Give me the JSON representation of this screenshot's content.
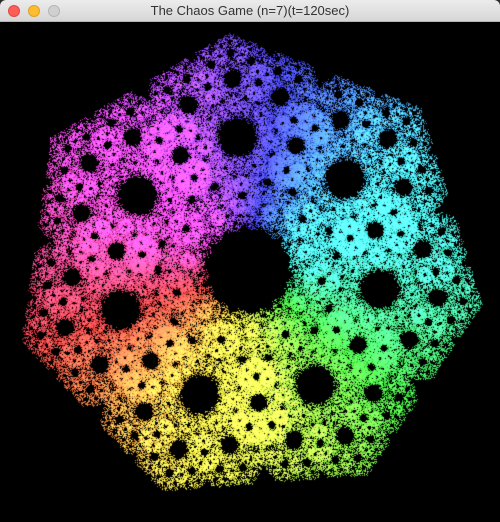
{
  "window": {
    "title": "The Chaos Game (n=7)(t=120sec)"
  },
  "controls": {
    "close_color": "#fd5f57",
    "close_border": "#de4a42",
    "minimize_color": "#febc2e",
    "minimize_border": "#dea123",
    "zoom_color": "#d0d0d0",
    "zoom_border": "#b5b5b5"
  },
  "canvas": {
    "background": "#000000",
    "fractal_vertices": 7
  }
}
